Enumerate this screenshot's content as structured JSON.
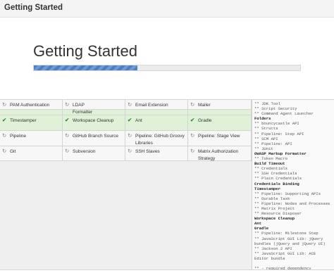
{
  "window": {
    "title": "Getting Started"
  },
  "main": {
    "title": "Getting Started",
    "progress": 0.39
  },
  "plugins": [
    {
      "name": "Folders",
      "status": "ok"
    },
    {
      "name": "OWASP Markup Formatter",
      "status": "ok"
    },
    {
      "name": "Build Timeout",
      "status": "ok"
    },
    {
      "name": "Credentials Binding",
      "status": "ok"
    },
    {
      "name": "Timestamper",
      "status": "ok"
    },
    {
      "name": "Workspace Cleanup",
      "status": "ok"
    },
    {
      "name": "Ant",
      "status": "ok"
    },
    {
      "name": "Gradle",
      "status": "ok"
    },
    {
      "name": "Pipeline",
      "status": "pending"
    },
    {
      "name": "GitHub Branch Source",
      "status": "pending"
    },
    {
      "name": "Pipeline: GitHub Groovy Libraries",
      "status": "pending"
    },
    {
      "name": "Pipeline: Stage View",
      "status": "pending"
    },
    {
      "name": "Git",
      "status": "pending"
    },
    {
      "name": "Subversion",
      "status": "pending"
    },
    {
      "name": "SSH Slaves",
      "status": "pending"
    },
    {
      "name": "Matrix Authorization Strategy",
      "status": "pending"
    },
    {
      "name": "PAM Authentication",
      "status": "pending"
    },
    {
      "name": "LDAP",
      "status": "pending"
    },
    {
      "name": "Email Extension",
      "status": "pending"
    },
    {
      "name": "Mailer",
      "status": "pending"
    }
  ],
  "icons": {
    "ok": "checkmark-icon",
    "pending": "spinner-icon"
  },
  "log": [
    {
      "t": "** JDK Tool",
      "h": false
    },
    {
      "t": "** Script Security",
      "h": false
    },
    {
      "t": "** Command Agent Launcher",
      "h": false
    },
    {
      "t": "Folders",
      "h": true
    },
    {
      "t": "** bouncycastle API",
      "h": false
    },
    {
      "t": "** Structs",
      "h": false
    },
    {
      "t": "** Pipeline: Step API",
      "h": false
    },
    {
      "t": "** SCM API",
      "h": false
    },
    {
      "t": "** Pipeline: API",
      "h": false
    },
    {
      "t": "** JUnit",
      "h": false
    },
    {
      "t": "OWASP Markup Formatter",
      "h": true
    },
    {
      "t": "** Token Macro",
      "h": false
    },
    {
      "t": "Build Timeout",
      "h": true
    },
    {
      "t": "** Credentials",
      "h": false
    },
    {
      "t": "** SSH Credentials",
      "h": false
    },
    {
      "t": "** Plain Credentials",
      "h": false
    },
    {
      "t": "Credentials Binding",
      "h": true
    },
    {
      "t": "Timestamper",
      "h": true
    },
    {
      "t": "** Pipeline: Supporting APIs",
      "h": false
    },
    {
      "t": "** Durable Task",
      "h": false
    },
    {
      "t": "** Pipeline: Nodes and Processes",
      "h": false
    },
    {
      "t": "** Matrix Project",
      "h": false
    },
    {
      "t": "** Resource Disposer",
      "h": false
    },
    {
      "t": "Workspace Cleanup",
      "h": true
    },
    {
      "t": "Ant",
      "h": true
    },
    {
      "t": "Gradle",
      "h": true
    },
    {
      "t": "** Pipeline: Milestone Step",
      "h": false
    },
    {
      "t": "** JavaScript GUI Lib: jQuery",
      "h": false
    },
    {
      "t": "bundles (jQuery and jQuery UI)",
      "h": false
    },
    {
      "t": "** Jackson 2 API",
      "h": false
    },
    {
      "t": "** JavaScript GUI Lib: ACE",
      "h": false
    },
    {
      "t": "Editor bundle",
      "h": false
    },
    {
      "t": "",
      "h": false
    },
    {
      "t": "** - required dependency",
      "h": false
    }
  ]
}
